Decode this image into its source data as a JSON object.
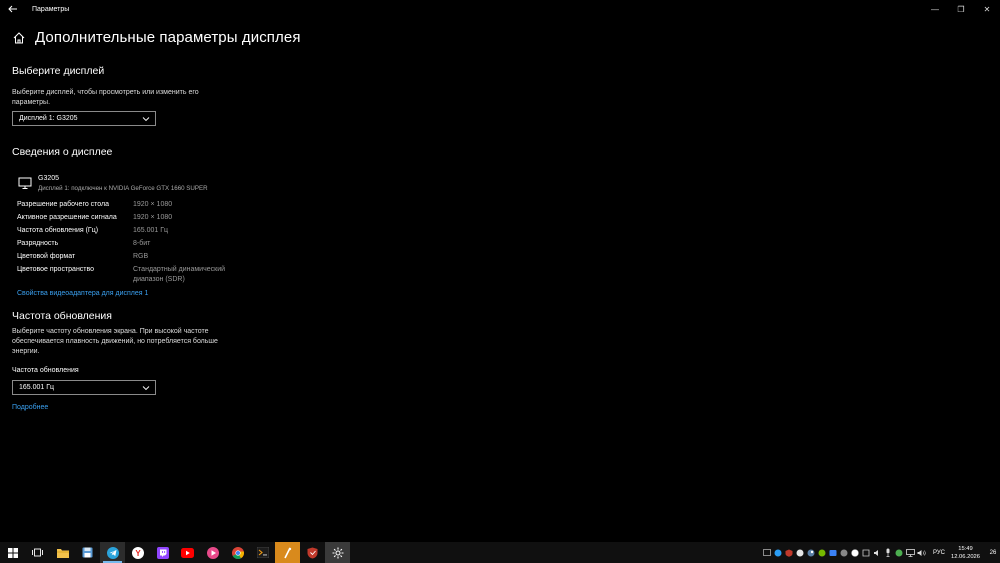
{
  "window": {
    "title": "Параметры",
    "controls": [
      "—",
      "❐",
      "✕"
    ]
  },
  "page": {
    "title": "Дополнительные параметры дисплея"
  },
  "choose_display": {
    "heading": "Выберите дисплей",
    "description": "Выберите дисплей, чтобы просмотреть или изменить его параметры.",
    "selected": "Дисплей 1: G3205"
  },
  "display_info": {
    "heading": "Сведения о дисплее",
    "monitor_name": "G3205",
    "monitor_sub": "Дисплей 1: подключен к NVIDIA GeForce GTX 1660 SUPER",
    "rows": [
      {
        "key": "Разрешение рабочего стола",
        "value": "1920 × 1080"
      },
      {
        "key": "Активное разрешение сигнала",
        "value": "1920 × 1080"
      },
      {
        "key": "Частота обновления (Гц)",
        "value": "165.001 Гц"
      },
      {
        "key": "Разрядность",
        "value": "8-бит"
      },
      {
        "key": "Цветовой формат",
        "value": "RGB"
      },
      {
        "key": "Цветовое пространство",
        "value": "Стандартный динамический диапазон (SDR)"
      }
    ],
    "adapter_link": "Свойства видеоадаптера для дисплея 1"
  },
  "refresh": {
    "heading": "Частота обновления",
    "description": "Выберите частоту обновления экрана. При высокой частоте обеспечивается плавность движений, но потребляется больше энергии.",
    "label": "Частота обновления",
    "selected": "165.001 Гц",
    "more_link": "Подробнее"
  },
  "taskbar": {
    "apps": [
      "start-icon",
      "task-view-icon",
      "file-explorer-icon",
      "save-icon",
      "telegram-icon",
      "yandex-browser-icon",
      "twitch-icon",
      "youtube-icon",
      "video-player-icon",
      "chrome-icon",
      "terminal-icon",
      "photo-editor-icon",
      "antivirus-icon",
      "settings-icon"
    ],
    "tray_icons": [
      "tray-app-icon",
      "tray-app-icon",
      "tray-app-icon",
      "tray-app-icon",
      "steam-icon",
      "tray-app-icon",
      "tray-app-icon",
      "tray-app-icon",
      "tray-app-icon",
      "tray-app-icon",
      "speaker-icon",
      "microphone-icon",
      "tray-app-icon",
      "network-icon",
      "volume-icon"
    ],
    "language": "РУС",
    "time": "15:49",
    "date": "12.06.2026",
    "notifications": "26",
    "colors": {
      "background": "#101010",
      "accent": "#76b9ed"
    }
  }
}
